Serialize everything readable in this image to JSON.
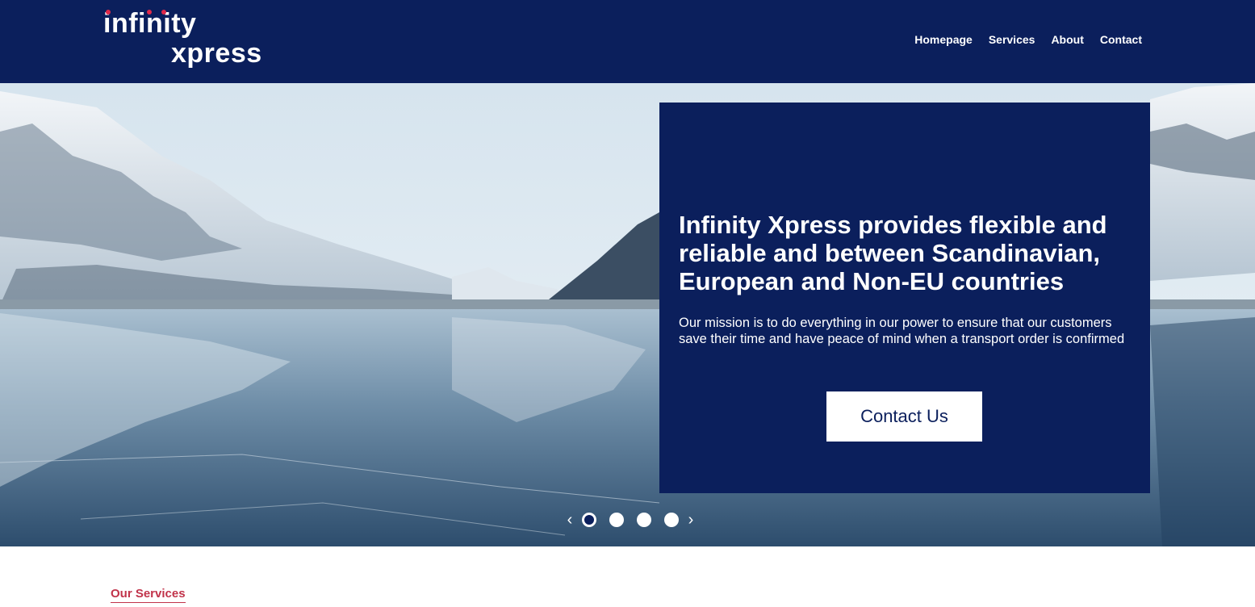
{
  "brand": {
    "logo_line1": "infinity",
    "logo_line2": "xpress",
    "colors": {
      "primary": "#0b1f5c",
      "accent": "#c1334a",
      "logo_dot": "#e0294a"
    }
  },
  "nav": {
    "items": [
      {
        "label": "Homepage"
      },
      {
        "label": "Services"
      },
      {
        "label": "About"
      },
      {
        "label": "Contact"
      }
    ]
  },
  "hero": {
    "title": "Infinity Xpress provides flexible and reliable and between Scandinavian, European and Non-EU countries",
    "subtitle": "Our mission is to do everything in our power to ensure that our customers save their time and have peace of mind when a transport order is confirmed",
    "cta_label": "Contact Us",
    "carousel": {
      "prev_icon": "chevron-left-icon",
      "next_icon": "chevron-right-icon",
      "slides": 4,
      "active_slide": 1
    }
  },
  "services": {
    "heading": "Our Services"
  }
}
